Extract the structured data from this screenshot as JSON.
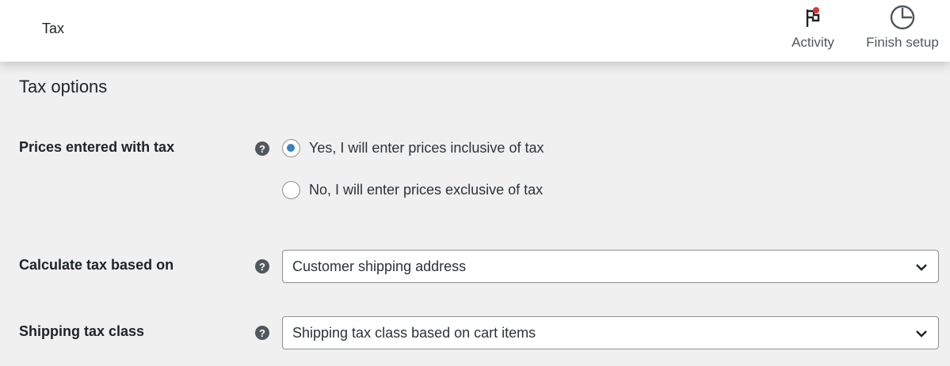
{
  "header": {
    "title": "Tax",
    "actions": [
      {
        "label": "Activity",
        "icon": "flag-icon",
        "badge_color": "#d63638"
      },
      {
        "label": "Finish setup",
        "icon": "progress-pie-icon"
      }
    ]
  },
  "tax_options": {
    "title": "Tax options",
    "prices_entered_with_tax": {
      "label": "Prices entered with tax",
      "help_icon": "?",
      "options": [
        {
          "label": "Yes, I will enter prices inclusive of tax",
          "checked": true
        },
        {
          "label": "No, I will enter prices exclusive of tax",
          "checked": false
        }
      ]
    },
    "calculate_tax_based_on": {
      "label": "Calculate tax based on",
      "help_icon": "?",
      "selected": "Customer shipping address"
    },
    "shipping_tax_class": {
      "label": "Shipping tax class",
      "help_icon": "?",
      "selected": "Shipping tax class based on cart items"
    }
  },
  "colors": {
    "accent": "#3582c4",
    "background": "#f0f0f1",
    "text": "#1d2327"
  }
}
